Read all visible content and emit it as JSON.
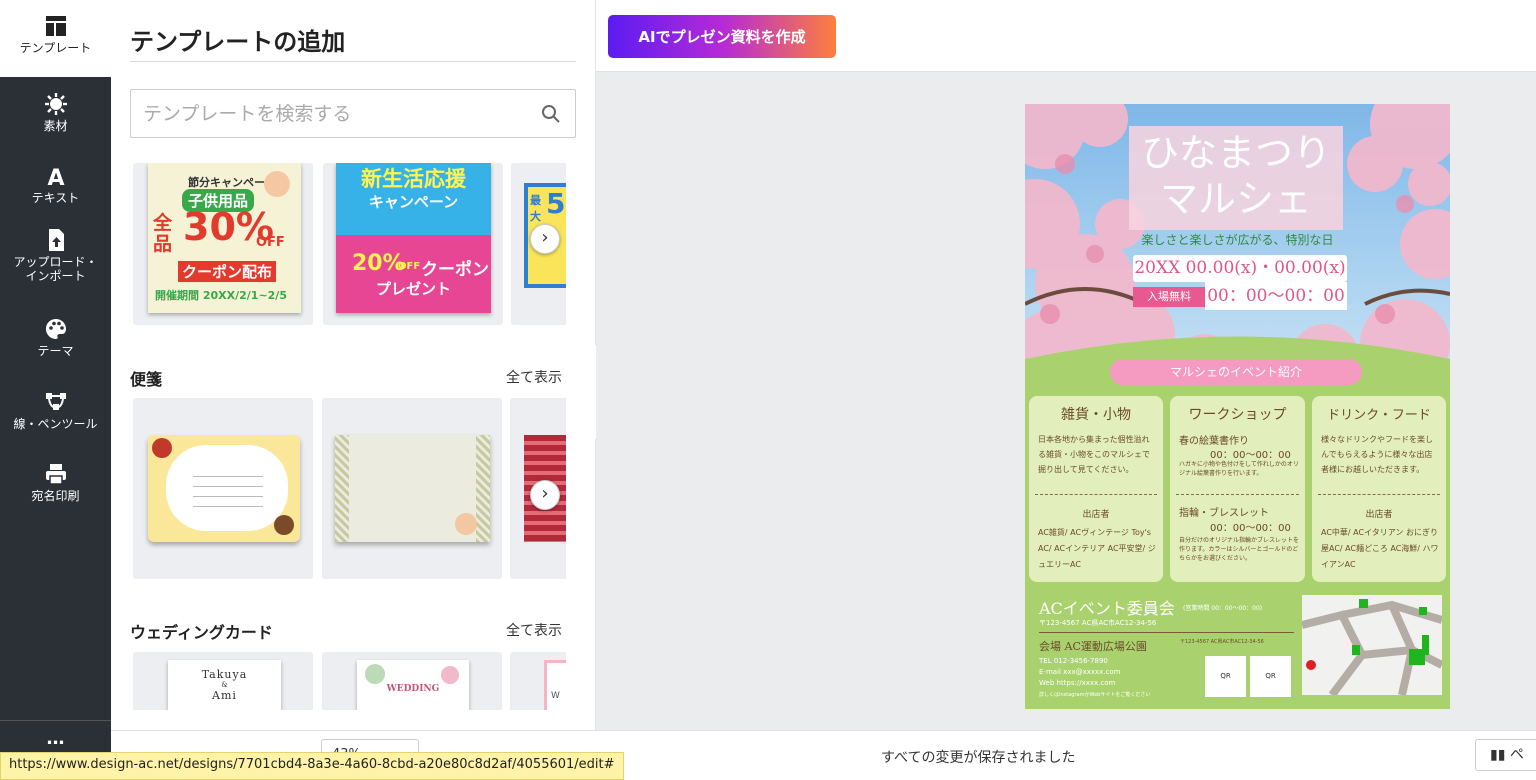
{
  "rail": {
    "template": "テンプレート",
    "material": "素材",
    "text": "テキスト",
    "upload": "アップロード・インポート",
    "theme": "テーマ",
    "lines": "線・ペンツール",
    "address": "宛名印刷",
    "more": "…"
  },
  "panel": {
    "title": "テンプレートの追加",
    "search_placeholder": "テンプレートを検索する",
    "sections": [
      {
        "title": "便箋",
        "link": "全て表示"
      },
      {
        "title": "ウェディングカード",
        "link": "全て表示"
      }
    ],
    "row1": {
      "card1": {
        "line1": "節分キャンペーン",
        "line2": "子供用品",
        "line3": "全品",
        "line4": "30%",
        "line5": "OFF",
        "line6": "クーポン配布",
        "line7": "開催期間 20XX/2/1~2/5"
      },
      "card2": {
        "line1": "新生活応援",
        "line2": "キャンペーン",
        "line3": "20%",
        "line4": "OFF",
        "line5": "クーポン",
        "line6": "プレゼント"
      },
      "card3": {
        "line1": "最大",
        "line2": "5"
      }
    },
    "row3": {
      "card1": {
        "line1": "Takuya",
        "line2": "&",
        "line3": "Ami"
      },
      "card2": {
        "line1": "WEDDING"
      },
      "card3": {
        "line1": "W"
      }
    }
  },
  "topbar": {
    "ai_button": "AIでプレゼン資料を作成"
  },
  "flyer": {
    "title_line1": "ひなまつり",
    "title_line2": "マルシェ",
    "subtitle": "楽しさと楽しさが広がる、特別な日",
    "date": "20XX 00.00(x)・00.00(x)",
    "free": "入場無料",
    "time": "00：00〜00：00",
    "events_label": "マルシェのイベント紹介",
    "col1": {
      "title": "雑貨・小物",
      "body": "日本各地から集まった個性溢れる雑貨・小物をこのマルシェで掘り出して見てください。",
      "shop_label": "出店者",
      "shops": "AC雑貨/ ACヴィンテージ Toy's AC/ ACインテリア AC平安堂/ ジュエリーAC"
    },
    "col2": {
      "title": "ワークショップ",
      "sub1": "春の絵葉書作り",
      "time1": "00：00〜00：00",
      "body1": "ハガキに小物や色付けをして作れしかのオリジナル絵葉書作りを行います。",
      "sub2": "指輪・ブレスレット",
      "time2": "00：00〜00：00",
      "body2": "自分だけのオリジナル指輪かブレスレットを作ります。カラーはシルバーとゴールドのどちらかをお選びください。"
    },
    "col3": {
      "title": "ドリンク・フード",
      "body": "様々なドリンクやフードを楽しんでもらえるように様々な出店者様にお越しいただきます。",
      "shop_label": "出店者",
      "shops": "AC中華/ ACイタリアン おにぎり屋AC/ AC麺どころ AC海鮮/ ハワイアンAC"
    },
    "footer": {
      "org": "ACイベント委員会",
      "org_hours": "(営業時間 00：00〜00：00)",
      "addr": "〒123-4567 AC県AC市AC12-34-56",
      "venue": "会場 AC運動広場公園",
      "venue_addr": "〒123-4567 AC県AC市AC12-34-56",
      "tel": "TEL 012-3456-7890",
      "mail": "E-mail xxx@xxxxx.com",
      "web": "Web https://xxxx.com",
      "note": "詳しくはInstagramかWebサイトをご覧ください",
      "qr1": "QR",
      "qr2": "QR"
    }
  },
  "bottom": {
    "saved": "すべての変更が保存されました",
    "right_label": "ペ",
    "zoom": "43%"
  },
  "status_url": "https://www.design-ac.net/designs/7701cbd4-8a3e-4a60-8cbd-a20e80c8d2af/4055601/edit#"
}
